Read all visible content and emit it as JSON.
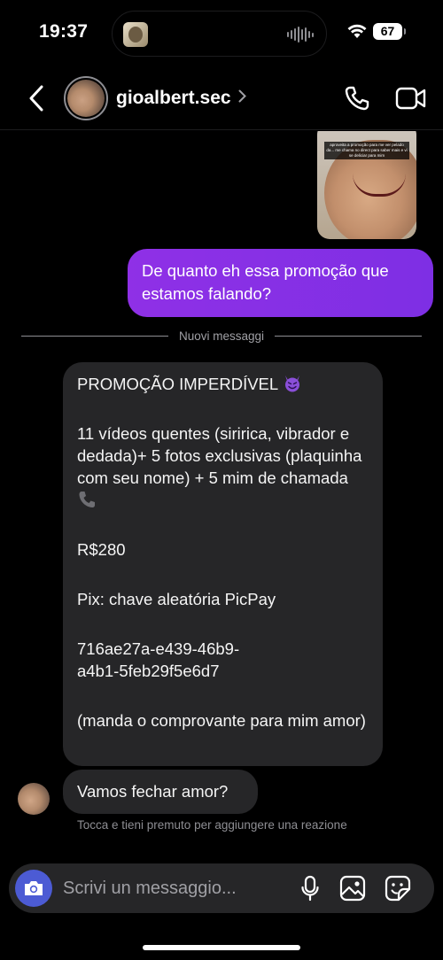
{
  "status_bar": {
    "time": "19:37",
    "battery": "67"
  },
  "header": {
    "username": "gioalbert.sec",
    "chevron": "›"
  },
  "messages": {
    "shared_image_caption": "aproveita a promoção para me ver pelado da... me chama no direct para saber mais e vi se deliciar para mim",
    "outgoing_1": "De quanto eh essa promoção que estamos falando?",
    "divider_label": "Nuovi messaggi",
    "promo": {
      "title": "PROMOÇÃO IMPERDÍVEL",
      "details": "11 vídeos quentes (siririca, vibrador e dedada)+ 5 fotos exclusivas (plaquinha com seu nome) + 5 mim de chamada",
      "price": "R$280",
      "pix": "Pix: chave aleatória PicPay",
      "key": "716ae27a-e439-46b9-a4b1-5feb29f5e6d7",
      "note": "(manda o comprovante para mim amor)"
    },
    "incoming_2": "Vamos fechar amor?",
    "reaction_hint": "Tocca e tieni premuto per aggiungere una reazione"
  },
  "composer": {
    "placeholder": "Scrivi un messaggio..."
  },
  "colors": {
    "outgoing_bubble": "#8f30e6",
    "incoming_bubble": "#262628",
    "camera_button": "#4c5bd4",
    "background": "#000000"
  },
  "icons": {
    "back": "chevron-left-icon",
    "call": "phone-icon",
    "video": "video-camera-icon",
    "camera": "camera-icon",
    "mic": "microphone-icon",
    "gallery": "image-icon",
    "sticker": "sticker-icon"
  }
}
